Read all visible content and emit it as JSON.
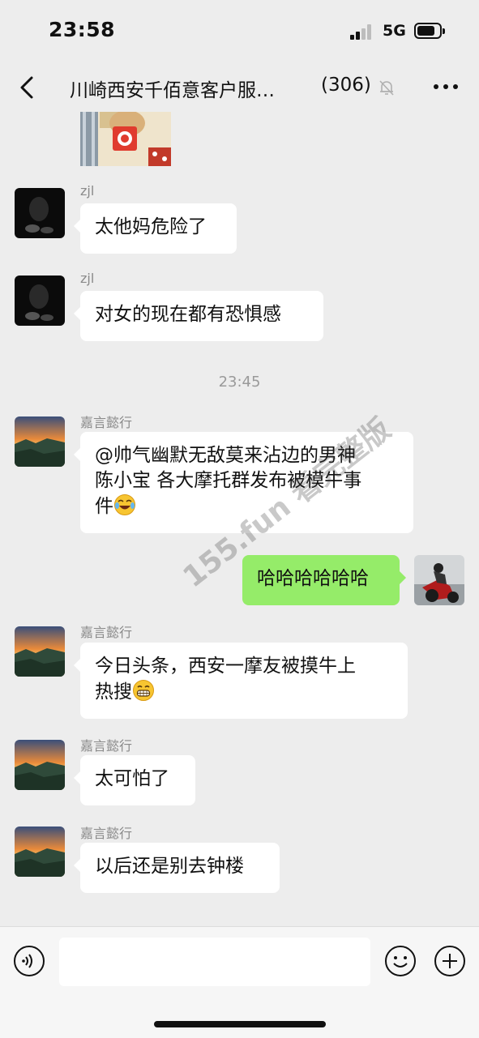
{
  "status_bar": {
    "time": "23:58",
    "network": "5G"
  },
  "header": {
    "title": "川崎西安千佰意客户服…",
    "member_count": "(306)"
  },
  "messages": [
    {
      "sender": "zjl",
      "text": "太他妈危险了"
    },
    {
      "sender": "zjl",
      "text": "对女的现在都有恐惧感"
    },
    {
      "timestamp": "23:45"
    },
    {
      "sender": "嘉言懿行",
      "lines": [
        "@帅气幽默无敌莫来沾边的男神",
        "陈小宝 各大摩托群发布被模牛事",
        "件"
      ],
      "emoji": "laughing-crying-emoji"
    },
    {
      "sender": "me",
      "text": "哈哈哈哈哈哈"
    },
    {
      "sender": "嘉言懿行",
      "lines": [
        "今日头条，西安一摩友被摸牛上",
        "热搜"
      ],
      "emoji": "grin-emoji"
    },
    {
      "sender": "嘉言懿行",
      "text": "太可怕了"
    },
    {
      "sender": "嘉言懿行",
      "text": "以后还是别去钟楼"
    }
  ],
  "watermark": "155.fun 看完整版",
  "colors": {
    "background": "#ededed",
    "self_bubble": "#95ec69",
    "other_bubble": "#ffffff"
  }
}
